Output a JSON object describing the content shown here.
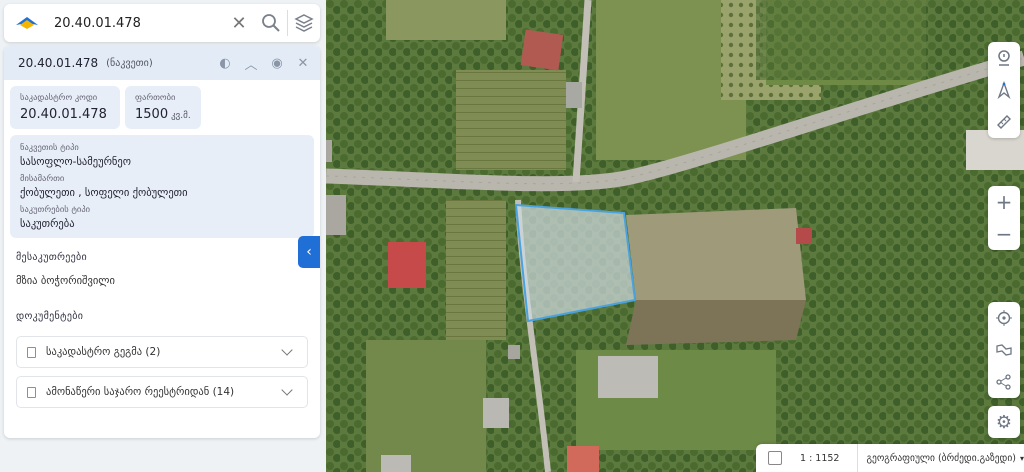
{
  "search": {
    "value": "20.40.01.478"
  },
  "parcel": {
    "id": "20.40.01.478",
    "type": "(ნაკვეთი)",
    "cadastral_label": "საკადასტრო კოდი",
    "cadastral_value": "20.40.01.478",
    "area_label": "ფართობი",
    "area_value": "1500",
    "area_unit": "კვ.მ.",
    "land_type_label": "ნაკვეთის ტიპი",
    "land_type_value": "სასოფლო-სამეურნეო",
    "address_label": "მისამართი",
    "address_value": "ქობულეთი , სოფელი ქობულეთი",
    "ownership_label": "საკუთრების ტიპი",
    "ownership_value": "საკუთრება"
  },
  "owners": {
    "title": "მესაკუთრეები",
    "name": "მზია ბოჭორიშვილი"
  },
  "documents": {
    "title": "დოკუმენტები",
    "items": [
      {
        "label": "საკადასტრო გეგმა (2)"
      },
      {
        "label": "ამონაწერი საჯარო რეესტრიდან (14)"
      }
    ]
  },
  "map": {
    "scale": "1 : 1152",
    "basemap": "გეოგრაფიული (ბრძედი.გაზედი)"
  },
  "icons": {
    "search": "search-icon",
    "clear": "close-icon",
    "layers": "layers-icon",
    "palette": "palette-icon",
    "collapse": "chevron-up-icon",
    "visibility": "eye-icon",
    "close": "close-icon",
    "info": "info-marker-icon",
    "north": "compass-icon",
    "measure": "ruler-icon",
    "zoom_in": "plus-icon",
    "zoom_out": "minus-icon",
    "locate": "crosshair-icon",
    "route": "route-icon",
    "share": "share-icon",
    "settings": "gear-icon"
  },
  "colors": {
    "accent": "#1f6fd6",
    "panel_header": "#e3ecf6",
    "card_bg": "#e8eef7",
    "parcel_outline": "#4aa3df"
  }
}
